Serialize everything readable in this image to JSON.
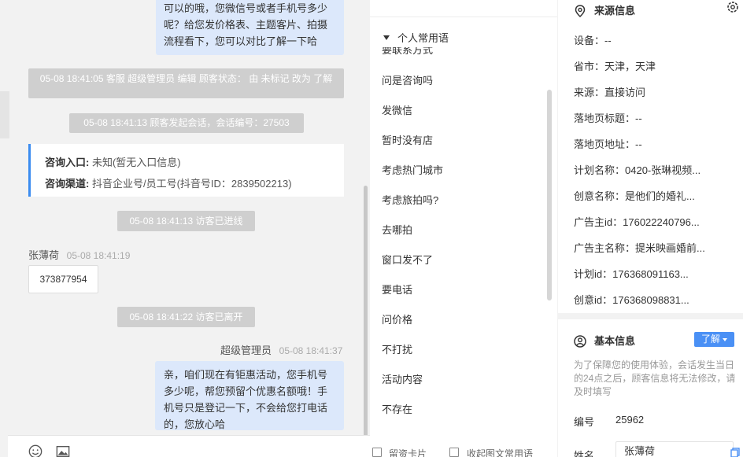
{
  "chat": {
    "top_bubble_text": "可以的哦，您微信号或者手机号多少呢？给您发价格表、主题客片、拍摄流程看下，您可以对比了解一下哈",
    "sys_status_change": "05-08 18:41:05 客服 超级管理员 编辑 顾客状态： 由 未标记 改为 了解",
    "sys_session_start": "05-08 18:41:13 顾客发起会话，会话编号：27503",
    "entry_card": {
      "entry_label": "咨询入口:",
      "entry_value": "未知(暂无入口信息)",
      "channel_label": "咨询渠道:",
      "channel_value": "抖音企业号/员工号(抖音号ID：2839502213)"
    },
    "sys_visitor_enter": "05-08 18:41:13 访客已进线",
    "visitor_name": "张薄荷",
    "visitor_time": "05-08 18:41:19",
    "visitor_message": "373877954",
    "sys_visitor_leave": "05-08 18:41:22 访客已离开",
    "agent_name": "超级管理员",
    "agent_time": "05-08 18:41:37",
    "agent_message": "亲，咱们现在有钜惠活动，您手机号多少呢，帮您预留个优惠名额哦！手机号只是登记一下，不会给您打电话的，您放心哈"
  },
  "phrases": {
    "group_title": "个人常用语",
    "partial_top_item": "要联系方式",
    "items": [
      "问是咨询吗",
      "发微信",
      "暂时没有店",
      "考虑热门城市",
      "考虑旅拍吗?",
      "去哪拍",
      "窗口发不了",
      "要电话",
      "问价格",
      "不打扰",
      "活动内容",
      "不存在"
    ],
    "footer_left": "留资卡片",
    "footer_right": "收起图文常用语"
  },
  "info": {
    "source_title": "来源信息",
    "source_rows": [
      {
        "label": "设备：",
        "value": "--"
      },
      {
        "label": "省市：",
        "value": "天津，天津"
      },
      {
        "label": "来源：",
        "value": "直接访问"
      },
      {
        "label": "落地页标题：",
        "value": "--"
      },
      {
        "label": "落地页地址：",
        "value": "--"
      },
      {
        "label": "计划名称：",
        "value": "0420-张琳视频..."
      },
      {
        "label": "创意名称：",
        "value": "是他们的婚礼..."
      },
      {
        "label": "广告主id：",
        "value": "176022240796..."
      },
      {
        "label": "广告主名称：",
        "value": "提米映画婚前..."
      },
      {
        "label": "计划id：",
        "value": "176368091163..."
      },
      {
        "label": "创意id：",
        "value": "176368098831..."
      }
    ],
    "basic_title": "基本信息",
    "learn_button": "了解",
    "note": "为了保障您的使用体验，会话发生当日的24点之后，顾客信息将无法修改，请及时填写",
    "number_label": "编号",
    "number_value": "25962",
    "name_label": "姓名",
    "name_value": "张薄荷"
  },
  "colors": {
    "accent": "#4a90f5",
    "bubble": "#dce8fb",
    "system_pill": "#cfcfcf",
    "card_border": "#3b8cf0"
  }
}
